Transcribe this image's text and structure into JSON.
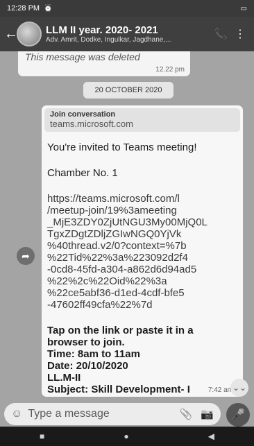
{
  "status_bar": {
    "time": "12:28 PM",
    "icons": [
      "alarm-icon",
      "battery-icon"
    ]
  },
  "header": {
    "title": "LLM II year. 2020- 2021",
    "members": "Adv. Amrit, Dodke, Ingulkar, Jagdhane,..."
  },
  "deleted_message": {
    "text": "This message was deleted",
    "time": "12.22 pm"
  },
  "date_chip": "20 OCTOBER 2020",
  "message": {
    "preview_title": "Join conversation",
    "preview_domain": "teams.microsoft.com",
    "invite": "You're invited to Teams meeting!",
    "chamber": "Chamber No. 1",
    "url": "https://teams.microsoft.com/l/meetup-join/19%3ameeting_MjE3ZDY0ZjUtNGU3My00MjQ0LTgxZDgtZDljZGIwNGQ0YjVk%40thread.v2/0?context=%7b%22Tid%22%3a%223092d2f4-0cd8-45fd-a304-a862d6d94ad5%22%2c%22Oid%22%3a%22ce5abf36-d1ed-4cdf-bfe5-47602ff49cfa%22%7d",
    "url_lines": [
      "https://teams.microsoft.com/l",
      "/meetup-join/19%3ameeting",
      "_MjE3ZDY0ZjUtNGU3My00MjQ0L",
      "TgxZDgtZDljZGIwNGQ0YjVk",
      "%40thread.v2/0?context=%7b",
      "%22Tid%22%3a%223092d2f4",
      "-0cd8-45fd-a304-a862d6d94ad5",
      "%22%2c%22Oid%22%3a",
      "%22ce5abf36-d1ed-4cdf-bfe5",
      "-47602ff49cfa%22%7d"
    ],
    "instructions": [
      "Tap on the link or paste it in a",
      "browser to join.",
      "Time: 8am to 11am",
      "Date: 20/10/2020",
      "LL.M-II",
      "Subject: Skill Development- I"
    ],
    "time": "7:42 am"
  },
  "input": {
    "placeholder": "Type a message"
  },
  "icons": {
    "back": "back-arrow-icon",
    "call": "add-call-icon",
    "menu": "more-options-icon",
    "forward": "forward-icon",
    "scroll": "scroll-down-icon",
    "emoji": "emoji-icon",
    "attach": "attach-icon",
    "camera": "camera-icon",
    "mic": "microphone-icon"
  }
}
